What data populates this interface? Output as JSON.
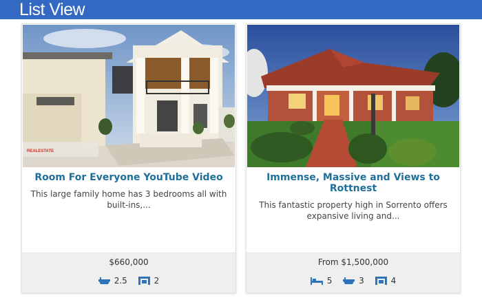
{
  "header": {
    "title": "List View"
  },
  "listings": [
    {
      "title": "Room For Everyone YouTube Video",
      "description": "This large family home has 3 bedrooms all with built-ins,...",
      "price": "$660,000",
      "baths": "2.5",
      "parking": "2",
      "logo_text": "REALESTATE"
    },
    {
      "title": "Immense, Massive and Views to Rottnest",
      "description": "This fantastic property high in Sorrento offers expansive living and...",
      "price": "From $1,500,000",
      "beds": "5",
      "baths": "3",
      "parking": "4"
    }
  ],
  "colors": {
    "header_bg": "#3469c3",
    "title": "#1f6f9b",
    "icon": "#2f73b8"
  },
  "icons": {
    "bed": "bed-icon",
    "bath": "bath-icon",
    "car": "car-icon"
  }
}
